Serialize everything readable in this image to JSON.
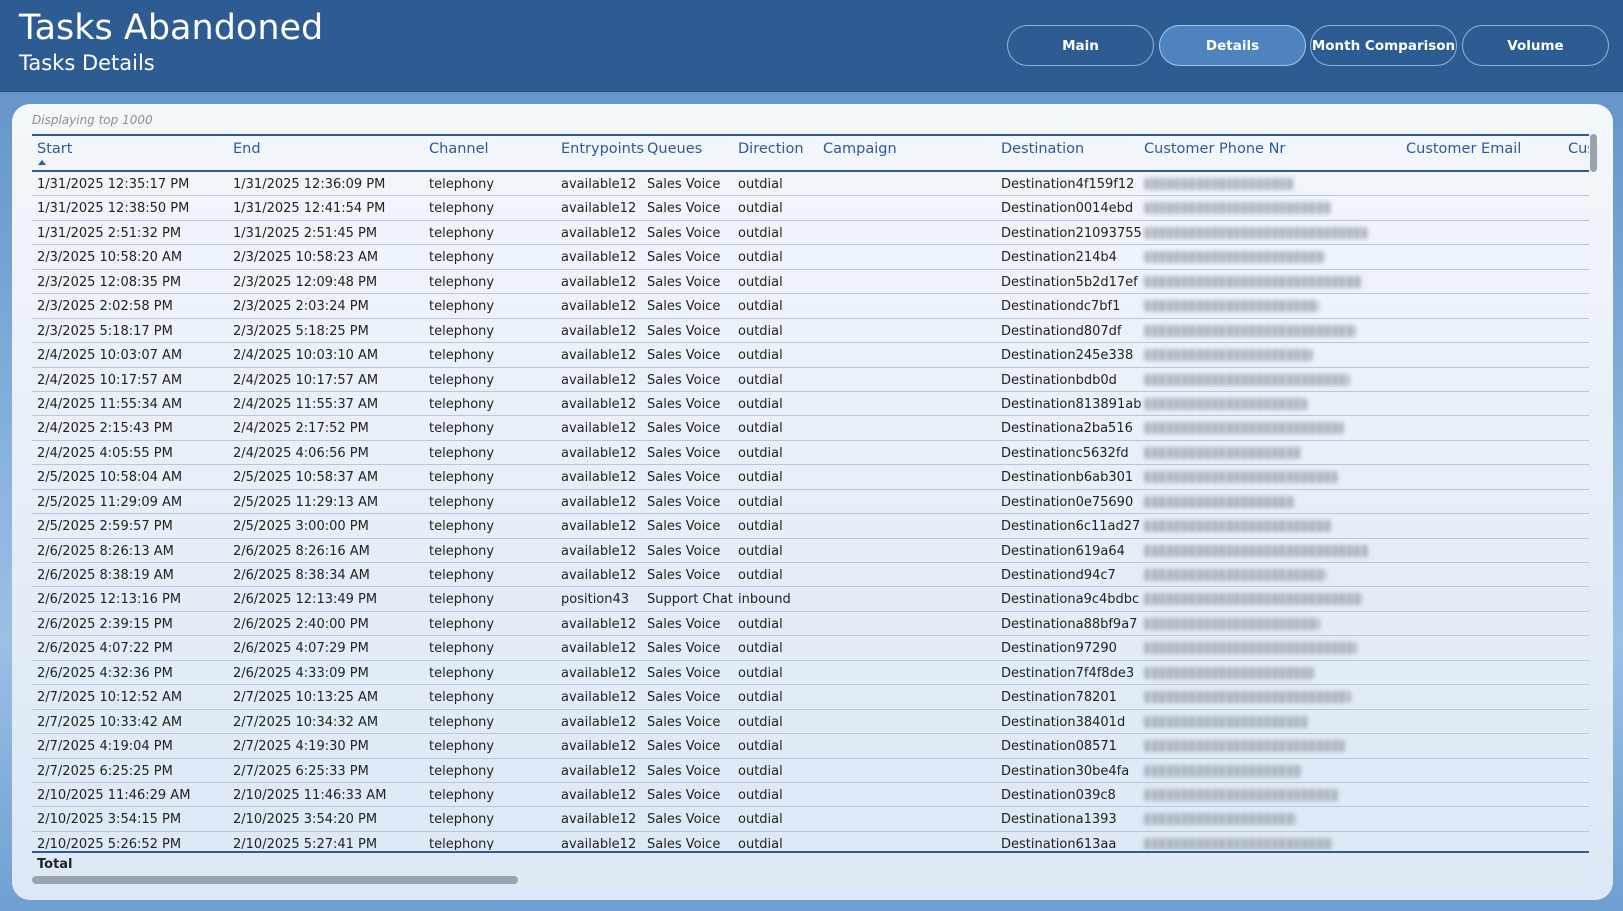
{
  "header": {
    "title": "Tasks Abandoned",
    "subtitle": "Tasks Details",
    "nav": [
      {
        "label": "Main",
        "active": false
      },
      {
        "label": "Details",
        "active": true
      },
      {
        "label": "Month Comparison",
        "active": false
      },
      {
        "label": "Volume",
        "active": false
      }
    ]
  },
  "colors": {
    "header_bg": "#2c5c91",
    "accent": "#2c5c91",
    "active_button": "#4e83c0"
  },
  "table": {
    "note": "Displaying top 1000",
    "sort_icon": "sort-ascending-icon",
    "columns": [
      "Start",
      "End",
      "Channel",
      "Entrypoints",
      "Queues",
      "Direction",
      "Campaign",
      "Destination",
      "Customer Phone Nr",
      "Customer Email",
      "Cus"
    ],
    "rows": [
      [
        "1/31/2025 12:35:17 PM",
        "1/31/2025 12:36:09 PM",
        "telephony",
        "available12",
        "Sales Voice",
        "outdial",
        "",
        "Destination4f159f12"
      ],
      [
        "1/31/2025 12:38:50 PM",
        "1/31/2025 12:41:54 PM",
        "telephony",
        "available12",
        "Sales Voice",
        "outdial",
        "",
        "Destination0014ebd"
      ],
      [
        "1/31/2025 2:51:32 PM",
        "1/31/2025 2:51:45 PM",
        "telephony",
        "available12",
        "Sales Voice",
        "outdial",
        "",
        "Destination21093755"
      ],
      [
        "2/3/2025 10:58:20 AM",
        "2/3/2025 10:58:23 AM",
        "telephony",
        "available12",
        "Sales Voice",
        "outdial",
        "",
        "Destination214b4"
      ],
      [
        "2/3/2025 12:08:35 PM",
        "2/3/2025 12:09:48 PM",
        "telephony",
        "available12",
        "Sales Voice",
        "outdial",
        "",
        "Destination5b2d17ef"
      ],
      [
        "2/3/2025 2:02:58 PM",
        "2/3/2025 2:03:24 PM",
        "telephony",
        "available12",
        "Sales Voice",
        "outdial",
        "",
        "Destinationdc7bf1"
      ],
      [
        "2/3/2025 5:18:17 PM",
        "2/3/2025 5:18:25 PM",
        "telephony",
        "available12",
        "Sales Voice",
        "outdial",
        "",
        "Destinationd807df"
      ],
      [
        "2/4/2025 10:03:07 AM",
        "2/4/2025 10:03:10 AM",
        "telephony",
        "available12",
        "Sales Voice",
        "outdial",
        "",
        "Destination245e338"
      ],
      [
        "2/4/2025 10:17:57 AM",
        "2/4/2025 10:17:57 AM",
        "telephony",
        "available12",
        "Sales Voice",
        "outdial",
        "",
        "Destinationbdb0d"
      ],
      [
        "2/4/2025 11:55:34 AM",
        "2/4/2025 11:55:37 AM",
        "telephony",
        "available12",
        "Sales Voice",
        "outdial",
        "",
        "Destination813891ab"
      ],
      [
        "2/4/2025 2:15:43 PM",
        "2/4/2025 2:17:52 PM",
        "telephony",
        "available12",
        "Sales Voice",
        "outdial",
        "",
        "Destinationa2ba516"
      ],
      [
        "2/4/2025 4:05:55 PM",
        "2/4/2025 4:06:56 PM",
        "telephony",
        "available12",
        "Sales Voice",
        "outdial",
        "",
        "Destinationc5632fd"
      ],
      [
        "2/5/2025 10:58:04 AM",
        "2/5/2025 10:58:37 AM",
        "telephony",
        "available12",
        "Sales Voice",
        "outdial",
        "",
        "Destinationb6ab301"
      ],
      [
        "2/5/2025 11:29:09 AM",
        "2/5/2025 11:29:13 AM",
        "telephony",
        "available12",
        "Sales Voice",
        "outdial",
        "",
        "Destination0e75690"
      ],
      [
        "2/5/2025 2:59:57 PM",
        "2/5/2025 3:00:00 PM",
        "telephony",
        "available12",
        "Sales Voice",
        "outdial",
        "",
        "Destination6c11ad27"
      ],
      [
        "2/6/2025 8:26:13 AM",
        "2/6/2025 8:26:16 AM",
        "telephony",
        "available12",
        "Sales Voice",
        "outdial",
        "",
        "Destination619a64"
      ],
      [
        "2/6/2025 8:38:19 AM",
        "2/6/2025 8:38:34 AM",
        "telephony",
        "available12",
        "Sales Voice",
        "outdial",
        "",
        "Destinationd94c7"
      ],
      [
        "2/6/2025 12:13:16 PM",
        "2/6/2025 12:13:49 PM",
        "telephony",
        "position43",
        "Support Chat",
        "inbound",
        "",
        "Destinationa9c4bdbc"
      ],
      [
        "2/6/2025 2:39:15 PM",
        "2/6/2025 2:40:00 PM",
        "telephony",
        "available12",
        "Sales Voice",
        "outdial",
        "",
        "Destinationa88bf9a7"
      ],
      [
        "2/6/2025 4:07:22 PM",
        "2/6/2025 4:07:29 PM",
        "telephony",
        "available12",
        "Sales Voice",
        "outdial",
        "",
        "Destination97290"
      ],
      [
        "2/6/2025 4:32:36 PM",
        "2/6/2025 4:33:09 PM",
        "telephony",
        "available12",
        "Sales Voice",
        "outdial",
        "",
        "Destination7f4f8de3"
      ],
      [
        "2/7/2025 10:12:52 AM",
        "2/7/2025 10:13:25 AM",
        "telephony",
        "available12",
        "Sales Voice",
        "outdial",
        "",
        "Destination78201"
      ],
      [
        "2/7/2025 10:33:42 AM",
        "2/7/2025 10:34:32 AM",
        "telephony",
        "available12",
        "Sales Voice",
        "outdial",
        "",
        "Destination38401d"
      ],
      [
        "2/7/2025 4:19:04 PM",
        "2/7/2025 4:19:30 PM",
        "telephony",
        "available12",
        "Sales Voice",
        "outdial",
        "",
        "Destination08571"
      ],
      [
        "2/7/2025 6:25:25 PM",
        "2/7/2025 6:25:33 PM",
        "telephony",
        "available12",
        "Sales Voice",
        "outdial",
        "",
        "Destination30be4fa"
      ],
      [
        "2/10/2025 11:46:29 AM",
        "2/10/2025 11:46:33 AM",
        "telephony",
        "available12",
        "Sales Voice",
        "outdial",
        "",
        "Destination039c8"
      ],
      [
        "2/10/2025 3:54:15 PM",
        "2/10/2025 3:54:20 PM",
        "telephony",
        "available12",
        "Sales Voice",
        "outdial",
        "",
        "Destinationa1393"
      ],
      [
        "2/10/2025 5:26:52 PM",
        "2/10/2025 5:27:41 PM",
        "telephony",
        "available12",
        "Sales Voice",
        "outdial",
        "",
        "Destination613aa"
      ]
    ],
    "total_label": "Total"
  }
}
